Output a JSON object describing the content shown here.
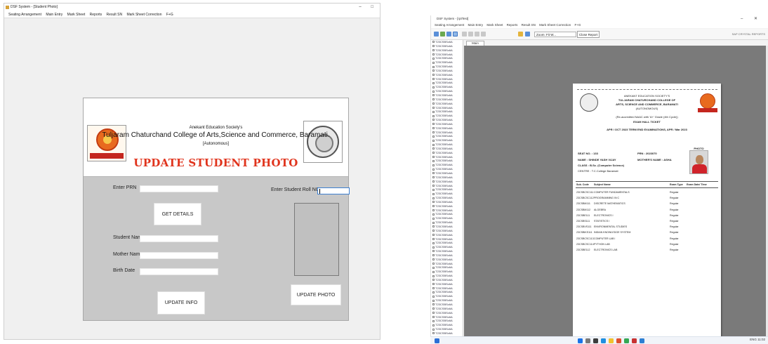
{
  "left_window": {
    "title": "DSF System - [Student Photo]",
    "window_controls": "– □",
    "menu": [
      "Seating Arrangement",
      "Main Entry",
      "Mark Sheet",
      "Reports",
      "Result SN",
      "Mark Sheet Correction",
      "F+G"
    ],
    "form": {
      "society_name": "Anekant Education Society's",
      "college_name": "Tuljaram Chaturchand College of Arts,Science and Commerce, Baramati.",
      "college_subtitle": "[Autonomous]",
      "form_title": "UPDATE STUDENT PHOTO",
      "prn_label": "Enter PRN",
      "prn_value": "",
      "roll_label": "Enter Student Roll NO",
      "roll_value": "",
      "get_details_label": "GET DETAILS",
      "student_name_label": "Student Name",
      "student_name_value": "",
      "mother_name_label": "Mother Name",
      "mother_name_value": "",
      "birth_date_label": "Birth Date",
      "birth_date_value": "",
      "update_info_label": "UPDATE INFO",
      "update_photo_label": "UPDATE PHOTO",
      "colors": {
        "title_red": "#e0341d",
        "body_gray": "#c8c8c8"
      }
    }
  },
  "right_window": {
    "title": "DSF System - [rptTest]",
    "window_controls": "– ✕",
    "menu": [
      "Seating Arrangement",
      "Main Entry",
      "Mark Sheet",
      "Reports",
      "Result SN",
      "Mark Sheet Correction",
      "F+G"
    ],
    "toolbar": {
      "zoom_value": "Zoom: Fit W...",
      "close_button_label": "Close Report",
      "right_text": "SAP CRYSTAL REPORTS"
    },
    "tree_item_label": "T23CSBSc6A",
    "tab_label": "Main Report",
    "status": {
      "left": "Current Page No.: 1",
      "middle": "Total Page No.: 1+",
      "right": "Zoom Factor: 100%"
    },
    "report": {
      "society": "ANEKANT EDUCATION SOCIETY'S",
      "college_1": "TULJARAM CHATURCHAND COLLEGE OF",
      "college_2": "ARTS, SCIENCE AND COMMERCE, BARAMATI",
      "autonomous": "(AUTONOMOUS)",
      "reaccredited": "(Re-accredited NAAC with 'A+' Grade (4th Cycle))",
      "hall_ticket": "EXAM HALL TICKET",
      "exam": "APR / OCT 2023 TERM END EXAMINATIONS, APR / Mar 2023",
      "photo_label": "PHOTO",
      "seat_no": "SEAT NO. : 133",
      "prn": "PRN : 2023070",
      "name": "NAME : SHINDE YASH VIJAY",
      "mother": "MOTHER'S NAME : ASHA",
      "class": "CLASS : B.Sc. (Computer Science)",
      "centre": "CENTRE : T.C.College Baramati",
      "table_headers": [
        "Sub. Code",
        "Subject Name",
        "Exam Type",
        "Exam Date/ Time"
      ],
      "rows": [
        [
          "23CSBCSC111",
          "COMPUTER FUNDAMENTALS",
          "Regular",
          ""
        ],
        [
          "23CSBCSC112",
          "PROGRAMMING IN C",
          "Regular",
          ""
        ],
        [
          "23CSBM111",
          "DISCRETE MATHEMATICS",
          "Regular",
          ""
        ],
        [
          "23CSBM112",
          "ALGEBRA",
          "Regular",
          ""
        ],
        [
          "23CSBE111",
          "ELECTRONICS I",
          "Regular",
          ""
        ],
        [
          "23CSBS111",
          "STATISTICS I",
          "Regular",
          ""
        ],
        [
          "23CSBVS111",
          "ENVIRONMENTAL STUDIES",
          "Regular",
          ""
        ],
        [
          "23CSBIKS111",
          "INDIAN KNOWLEDGE SYSTEM",
          "Regular",
          ""
        ],
        [
          "23CSBCSC113",
          "COMPUTER LAB I",
          "Regular",
          ""
        ],
        [
          "23CSBCSC114",
          "PYTHON LAB",
          "Regular",
          ""
        ],
        [
          "23CSBE112",
          "ELECTRONICS LAB",
          "Regular",
          ""
        ]
      ]
    }
  },
  "taskbar": {
    "tray_text": "ENG  11:02",
    "icons": [
      "start-icon",
      "search-icon",
      "taskview-icon",
      "explorer-icon",
      "edge-icon",
      "chrome-icon",
      "store-icon",
      "app-icon"
    ]
  }
}
